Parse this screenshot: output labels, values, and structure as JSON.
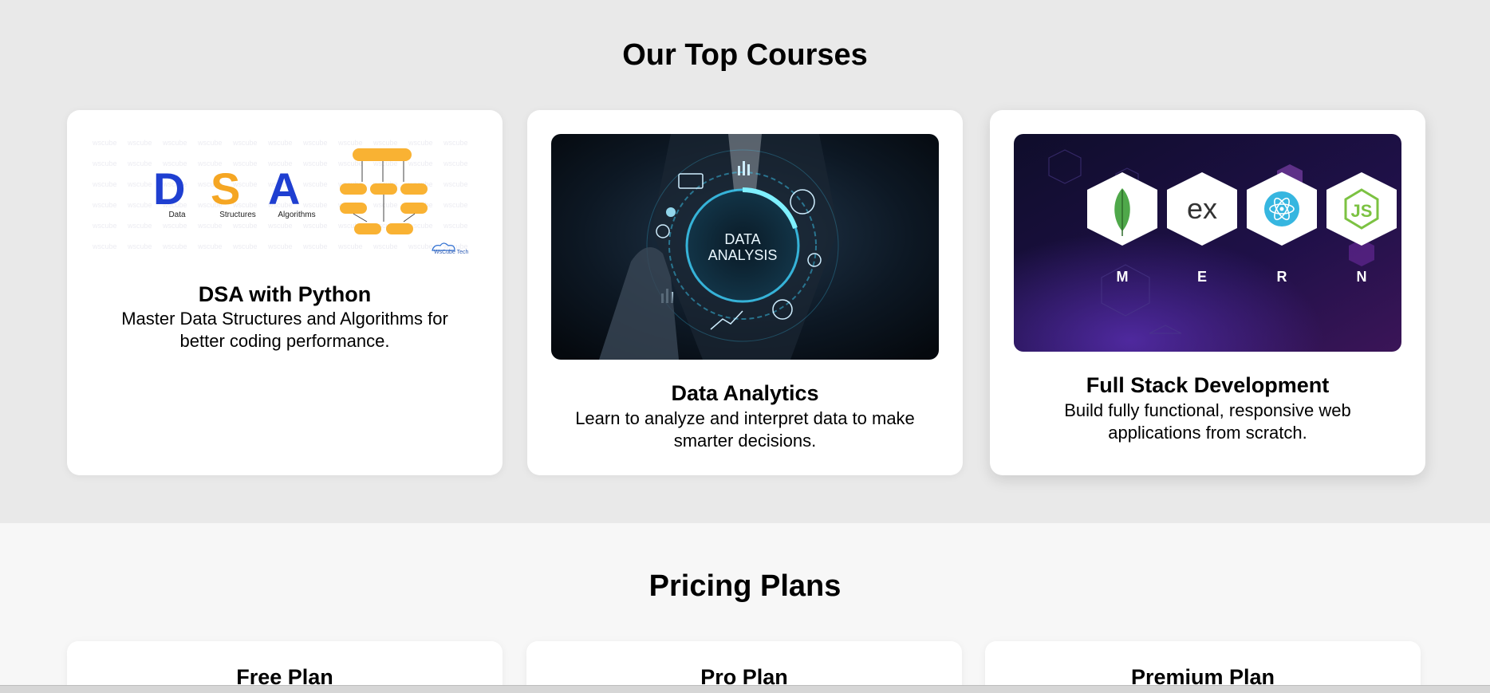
{
  "courses": {
    "heading": "Our Top Courses",
    "items": [
      {
        "title": "DSA with Python",
        "description": "Master Data Structures and Algorithms for better coding performance.",
        "image": {
          "letters": [
            "D",
            "S",
            "A"
          ],
          "captions": [
            "Data",
            "Structures",
            "Algorithms"
          ],
          "watermark": "WsCube Tech",
          "colors": {
            "d": "#1f3fd1",
            "s": "#f5a623",
            "a": "#1f3fd1",
            "blocks": "#f9b233"
          }
        }
      },
      {
        "title": "Data Analytics",
        "description": "Learn to analyze and interpret data to make smarter decisions.",
        "image": {
          "ring_text_1": "DATA",
          "ring_text_2": "ANALYSIS",
          "colors": {
            "bg": "#0b1622",
            "glow": "#3fd4ff"
          }
        }
      },
      {
        "title": "Full Stack Development",
        "description": "Build fully functional, responsive web applications from scratch.",
        "image": {
          "hex_labels": [
            "M",
            "E",
            "R",
            "N"
          ],
          "express_text": "ex",
          "icons": [
            "mongodb-leaf-icon",
            "express-icon",
            "react-atom-icon",
            "nodejs-icon"
          ],
          "colors": {
            "bg": "#170f3a",
            "accent": "#6b2a9c"
          }
        }
      }
    ]
  },
  "pricing": {
    "heading": "Pricing Plans",
    "plans": [
      {
        "title": "Free Plan"
      },
      {
        "title": "Pro Plan"
      },
      {
        "title": "Premium Plan"
      }
    ]
  }
}
